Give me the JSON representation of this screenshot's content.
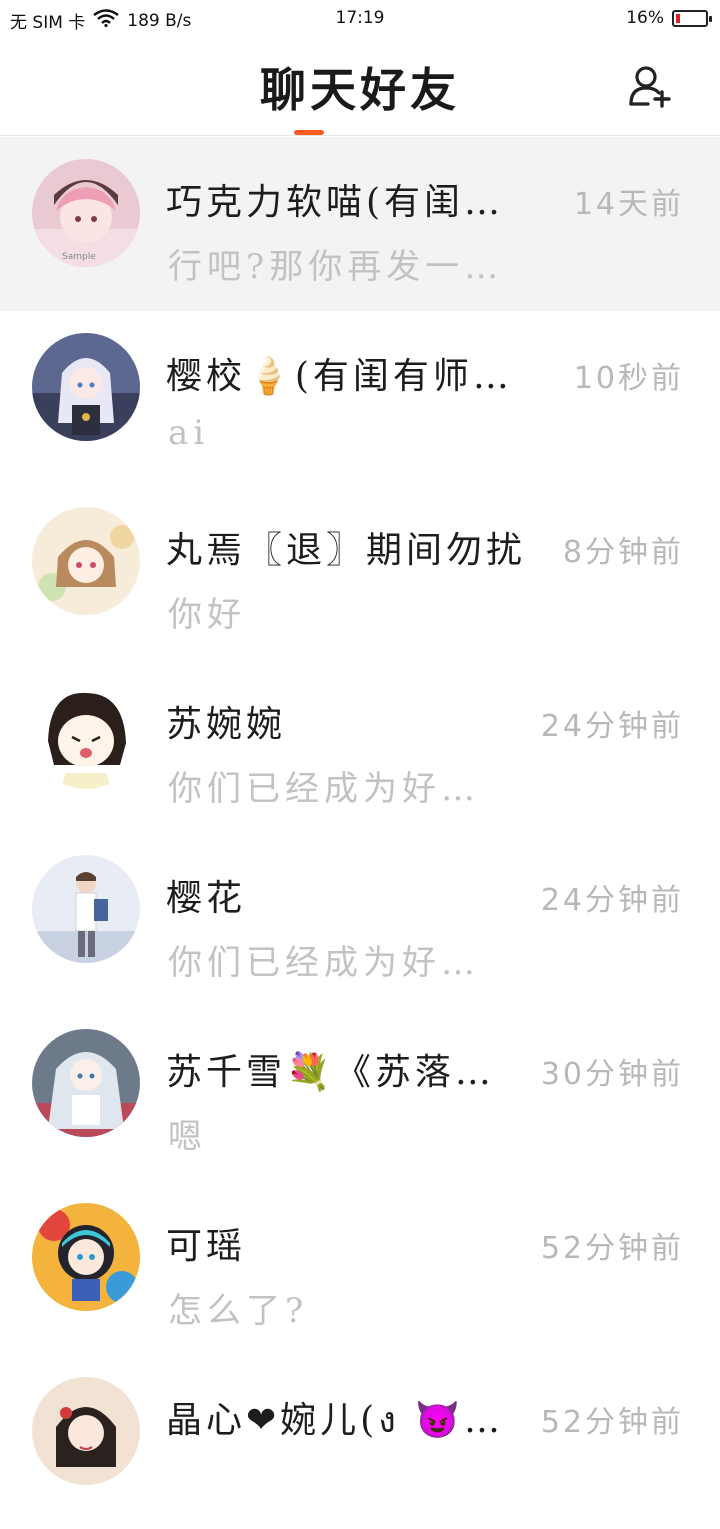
{
  "status_bar": {
    "carrier": "无 SIM 卡",
    "net_speed": "189 B/s",
    "time": "17:19",
    "battery": "16%",
    "battery_level": 0.16
  },
  "header": {
    "title": "聊天好友",
    "accent_color": "#ff5a1f",
    "add_icon": "add-user-icon"
  },
  "chats": [
    {
      "name": "巧克力软喵(有闺…",
      "time": "14天前",
      "preview": "行吧?那你再发一…"
    },
    {
      "name": "樱校🍦(有闺有师…",
      "time": "10秒前",
      "preview": "ai"
    },
    {
      "name": "丸焉〖退〗期间勿扰",
      "time": "8分钟前",
      "preview": "你好"
    },
    {
      "name": "苏婉婉",
      "time": "24分钟前",
      "preview": "你们已经成为好…"
    },
    {
      "name": "樱花",
      "time": "24分钟前",
      "preview": "你们已经成为好…"
    },
    {
      "name": "苏千雪💐《苏落…",
      "time": "30分钟前",
      "preview": "嗯"
    },
    {
      "name": "可瑶",
      "time": "52分钟前",
      "preview": "怎么了?"
    },
    {
      "name": "晶心❤婉儿(ง 😈…",
      "time": "52分钟前",
      "preview": ""
    }
  ]
}
